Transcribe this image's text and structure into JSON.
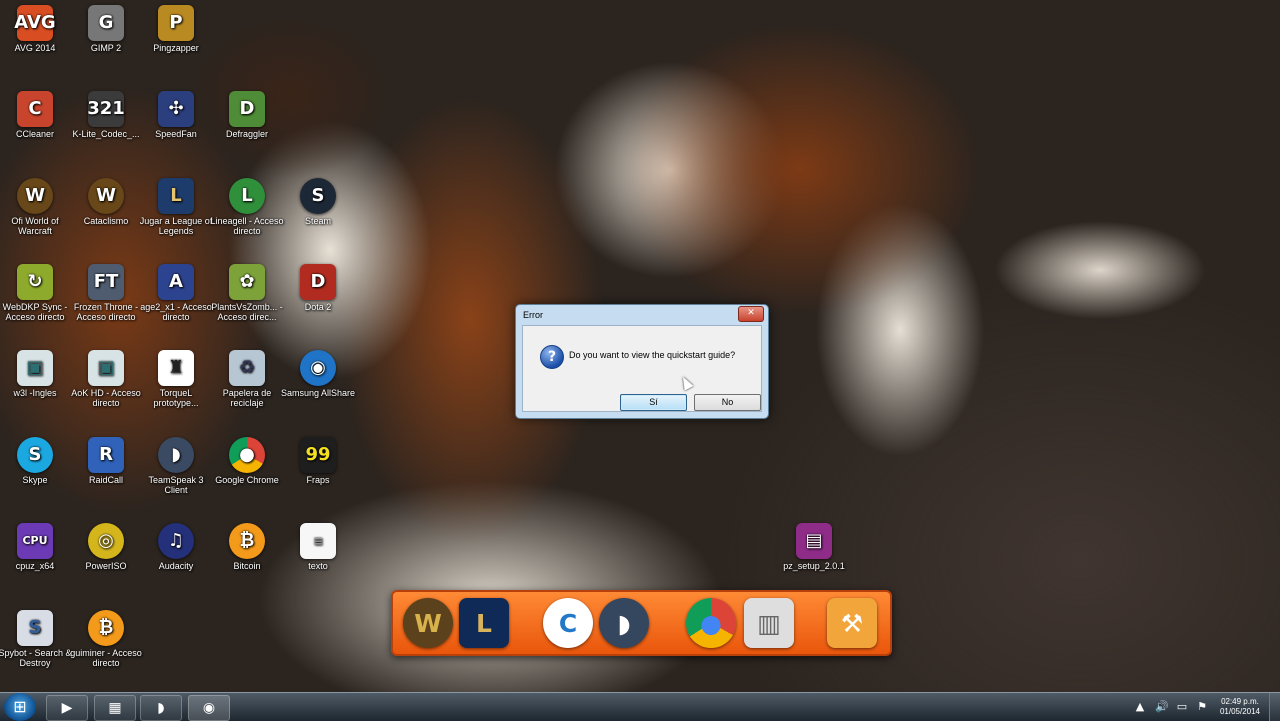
{
  "colors": {
    "accent": "#1e6fb5",
    "dock": "#f06b1f",
    "taskbar": "#1e2730"
  },
  "desktop_icons": [
    {
      "label": "AVG 2014",
      "icon": "avg-icon"
    },
    {
      "label": "GIMP 2",
      "icon": "gimp-icon"
    },
    {
      "label": "Pingzapper",
      "icon": "pingzapper-icon"
    },
    {
      "label": "CCleaner",
      "icon": "ccleaner-icon"
    },
    {
      "label": "K-Lite_Codec_...",
      "icon": "klite-codec-icon"
    },
    {
      "label": "SpeedFan",
      "icon": "speedfan-icon"
    },
    {
      "label": "Defraggler",
      "icon": "defraggler-icon"
    },
    {
      "label": "Ofi World of Warcraft",
      "icon": "wow-icon"
    },
    {
      "label": "Cataclismo",
      "icon": "wow-icon"
    },
    {
      "label": "Jugar a League of Legends",
      "icon": "league-of-legends-icon"
    },
    {
      "label": "Lineagell - Acceso directo",
      "icon": "lineage-icon"
    },
    {
      "label": "Steam",
      "icon": "steam-icon"
    },
    {
      "label": "WebDKP Sync - Acceso directo",
      "icon": "webdkp-icon"
    },
    {
      "label": "Frozen Throne - Acceso directo",
      "icon": "frozen-throne-icon"
    },
    {
      "label": "age2_x1 - Acceso directo",
      "icon": "age-of-empires-icon"
    },
    {
      "label": "PlantsVsZomb... - Acceso direc...",
      "icon": "plants-vs-zombies-icon"
    },
    {
      "label": "Dota 2",
      "icon": "dota2-icon"
    },
    {
      "label": "w3l -Ingles",
      "icon": "shortcut-icon"
    },
    {
      "label": "AoK HD - Acceso directo",
      "icon": "shortcut-icon"
    },
    {
      "label": "TorqueL prototype...",
      "icon": "torquel-icon"
    },
    {
      "label": "Papelera de reciclaje",
      "icon": "recycle-bin-icon"
    },
    {
      "label": "Samsung AllShare",
      "icon": "samsung-allshare-icon"
    },
    {
      "label": "Skype",
      "icon": "skype-icon"
    },
    {
      "label": "RaidCall",
      "icon": "raidcall-icon"
    },
    {
      "label": "TeamSpeak 3 Client",
      "icon": "teamspeak-icon"
    },
    {
      "label": "Google Chrome",
      "icon": "chrome-icon"
    },
    {
      "label": "Fraps",
      "icon": "fraps-icon"
    },
    {
      "label": "cpuz_x64",
      "icon": "cpuz-icon"
    },
    {
      "label": "PowerISO",
      "icon": "poweriso-icon"
    },
    {
      "label": "Audacity",
      "icon": "audacity-icon"
    },
    {
      "label": "Bitcoin",
      "icon": "bitcoin-icon"
    },
    {
      "label": "texto",
      "icon": "text-file-icon"
    },
    {
      "label": "pz_setup_2.0.1",
      "icon": "winrar-archive-icon"
    },
    {
      "label": "Spybot - Search & Destroy",
      "icon": "spybot-icon"
    },
    {
      "label": "guiminer - Acceso directo",
      "icon": "bitcoin-icon"
    }
  ],
  "dialog": {
    "title": "Error",
    "close_label": "✕",
    "message": "Do you want to view the quickstart guide?",
    "yes_label": "Sí",
    "no_label": "No"
  },
  "dock": {
    "items": [
      {
        "name": "wow-icon",
        "glyph": "W"
      },
      {
        "name": "league-of-legends-icon",
        "glyph": "L"
      },
      {
        "name": "ccleaner-icon",
        "glyph": "C"
      },
      {
        "name": "teamspeak-icon",
        "glyph": "◗"
      },
      {
        "name": "chrome-icon",
        "glyph": "◉"
      },
      {
        "name": "computer-icon",
        "glyph": "▥"
      },
      {
        "name": "tools-icon",
        "glyph": "✕"
      }
    ]
  },
  "taskbar": {
    "start_icon": "windows-logo-icon",
    "items": [
      "media-player-icon",
      "file-explorer-icon",
      "teamspeak-icon",
      "chrome-icon"
    ],
    "clock_time": "02:49 p.m.",
    "clock_date": "01/05/2014"
  }
}
